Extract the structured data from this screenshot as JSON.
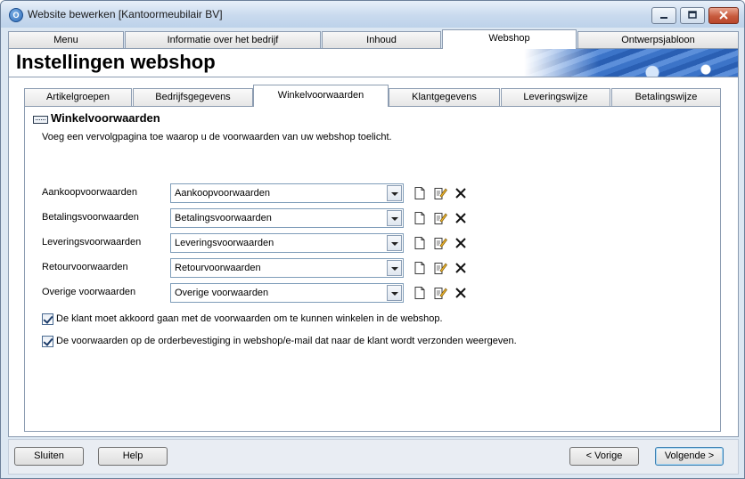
{
  "window": {
    "title": "Website bewerken [Kantoormeubilair BV]",
    "app_icon_glyph": "O"
  },
  "main_tabs": [
    {
      "label": "Menu"
    },
    {
      "label": "Informatie over het bedrijf"
    },
    {
      "label": "Inhoud"
    },
    {
      "label": "Webshop",
      "active": true
    },
    {
      "label": "Ontwerpsjabloon"
    }
  ],
  "header": {
    "title": "Instellingen webshop"
  },
  "sub_tabs": [
    {
      "label": "Artikelgroepen"
    },
    {
      "label": "Bedrijfsgegevens"
    },
    {
      "label": "Winkelvoorwaarden",
      "active": true
    },
    {
      "label": "Klantgegevens"
    },
    {
      "label": "Leveringswijze"
    },
    {
      "label": "Betalingswijze"
    }
  ],
  "section": {
    "title": "Winkelvoorwaarden",
    "description": "Voeg een vervolgpagina toe waarop u de voorwaarden van uw webshop toelicht."
  },
  "rows": [
    {
      "label": "Aankoopvoorwaarden",
      "value": "Aankoopvoorwaarden"
    },
    {
      "label": "Betalingsvoorwaarden",
      "value": "Betalingsvoorwaarden"
    },
    {
      "label": "Leveringsvoorwaarden",
      "value": "Leveringsvoorwaarden"
    },
    {
      "label": "Retourvoorwaarden",
      "value": "Retourvoorwaarden"
    },
    {
      "label": "Overige voorwaarden",
      "value": "Overige voorwaarden"
    }
  ],
  "row_icons": [
    "new-page-icon",
    "edit-page-icon",
    "delete-icon"
  ],
  "checkboxes": [
    {
      "label": "De klant moet akkoord gaan met de voorwaarden om te kunnen winkelen in de webshop.",
      "checked": true
    },
    {
      "label": "De voorwaarden op de orderbevestiging in webshop/e-mail dat naar de klant wordt verzonden weergeven.",
      "checked": true
    }
  ],
  "footer": {
    "close_label": "Sluiten",
    "help_label": "Help",
    "prev_label": "< Vorige",
    "next_label": "Volgende >"
  },
  "colors": {
    "titlebar": "#c9daee",
    "close_button": "#c75a3d",
    "border": "#8c9cb1",
    "banner_blue": "#3c74c8"
  }
}
